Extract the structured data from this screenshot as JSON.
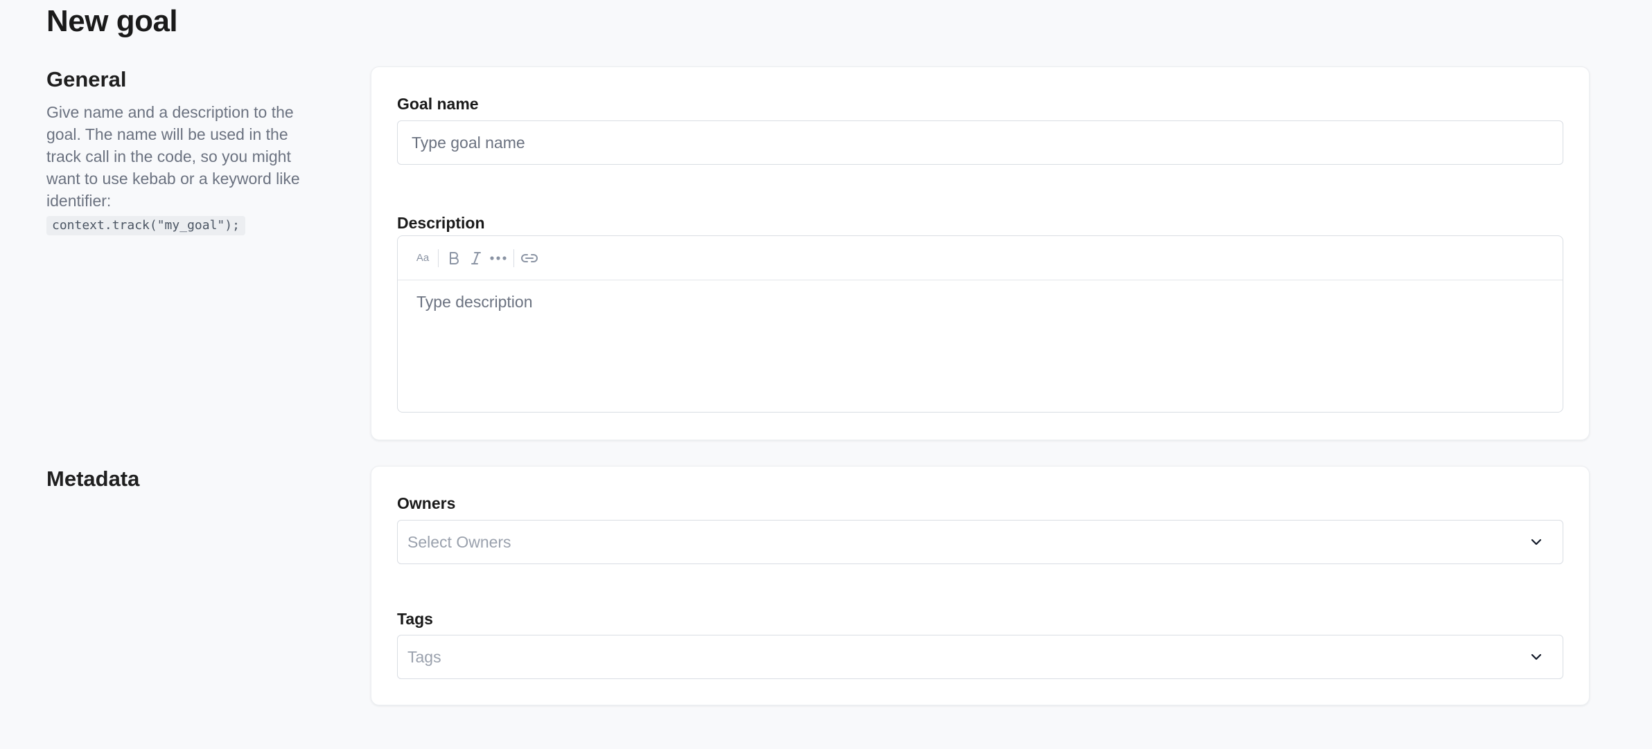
{
  "page": {
    "title": "New goal"
  },
  "general": {
    "heading": "General",
    "description": "Give name and a description to the goal. The name will be used in the track call in the code, so you might want to use kebab or a keyword like identifier:",
    "code_example": "context.track(\"my_goal\");",
    "goal_name": {
      "label": "Goal name",
      "placeholder": "Type goal name",
      "value": ""
    },
    "description_field": {
      "label": "Description",
      "placeholder": "Type description",
      "toolbar": [
        "text-size-icon",
        "bold-icon",
        "italic-icon",
        "more-icon",
        "link-icon"
      ],
      "text_size_glyph": "Aa"
    }
  },
  "metadata": {
    "heading": "Metadata",
    "owners": {
      "label": "Owners",
      "placeholder": "Select Owners"
    },
    "tags": {
      "label": "Tags",
      "placeholder": "Tags"
    }
  },
  "colors": {
    "background": "#f8f9fb",
    "card": "#ffffff",
    "border": "#d9dde3",
    "muted_text": "#6b7280",
    "heading_text": "#1a1a1a"
  }
}
